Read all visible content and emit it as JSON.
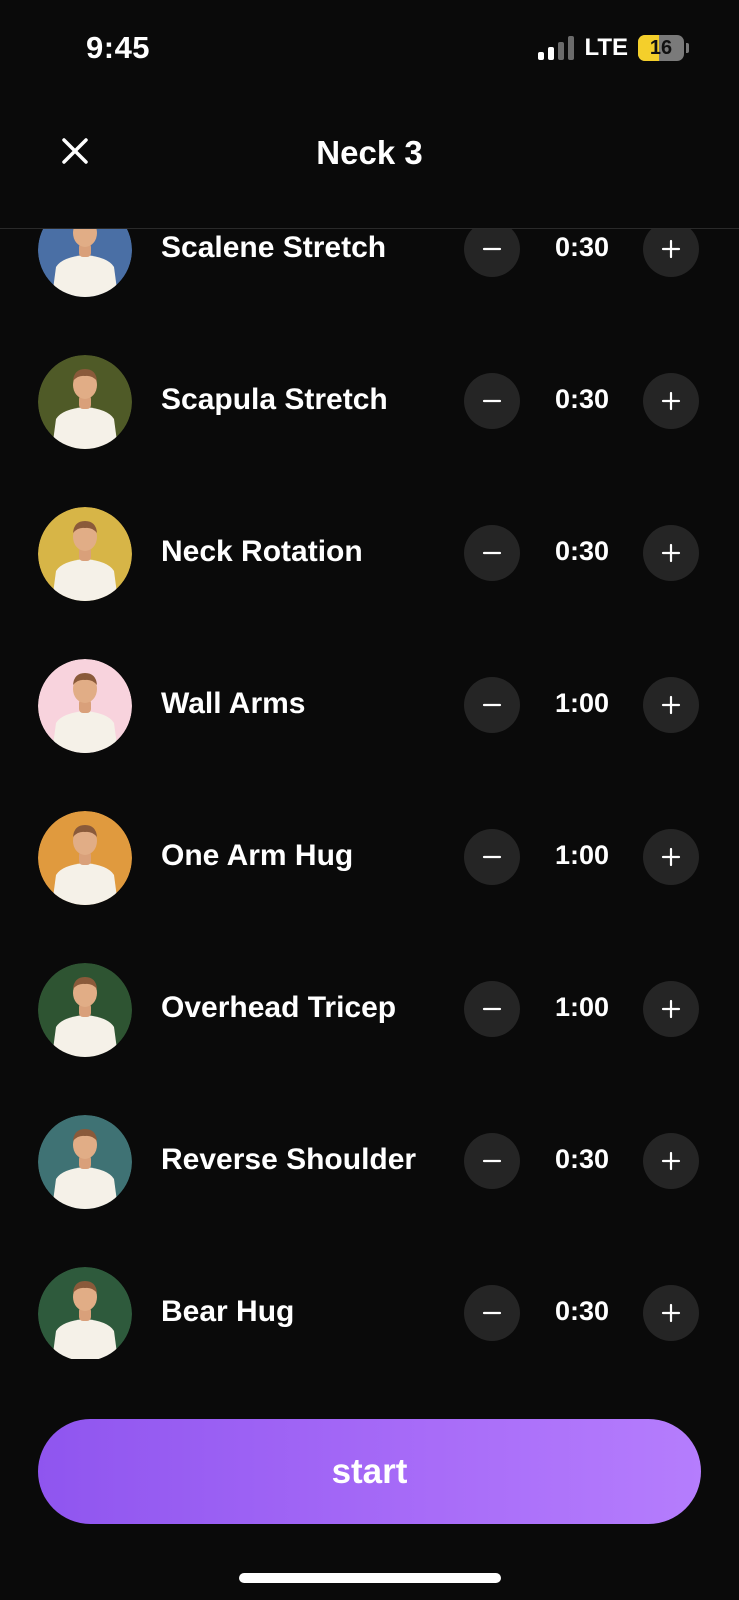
{
  "status_bar": {
    "time": "9:45",
    "network": "LTE",
    "battery": "16",
    "battery_level": 0.16
  },
  "header": {
    "title": "Neck 3",
    "close_icon": "close-icon"
  },
  "exercises": [
    {
      "name": "Scalene Stretch",
      "duration": "0:30",
      "bg": "#4a6fa5"
    },
    {
      "name": "Scapula Stretch",
      "duration": "0:30",
      "bg": "#4f5a27"
    },
    {
      "name": "Neck Rotation",
      "duration": "0:30",
      "bg": "#d7b547"
    },
    {
      "name": "Wall Arms",
      "duration": "1:00",
      "bg": "#f8d3dd"
    },
    {
      "name": "One Arm Hug",
      "duration": "1:00",
      "bg": "#e09a3e"
    },
    {
      "name": "Overhead Tricep",
      "duration": "1:00",
      "bg": "#2e5432"
    },
    {
      "name": "Reverse Shoulder",
      "duration": "0:30",
      "bg": "#3f7274"
    },
    {
      "name": "Bear Hug",
      "duration": "0:30",
      "bg": "#2e5a3c"
    }
  ],
  "stepper": {
    "minus_icon": "minus-icon",
    "plus_icon": "plus-icon"
  },
  "start_button": {
    "label": "start",
    "color": "#9b5ff3"
  }
}
